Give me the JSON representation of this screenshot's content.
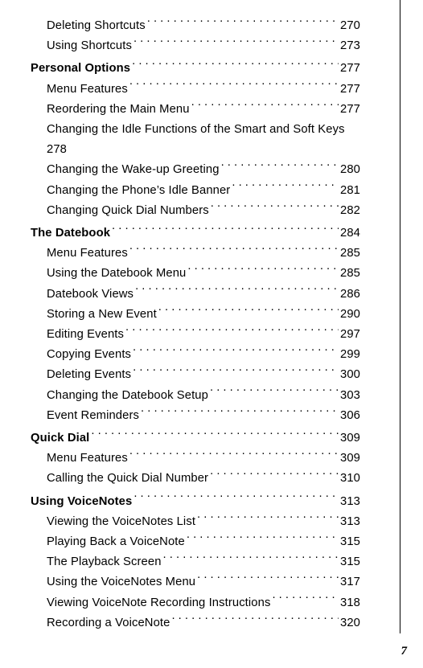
{
  "page_number": "7",
  "entries": [
    {
      "label": "Deleting Shortcuts",
      "page": "270",
      "bold": false,
      "indent": true,
      "breakBefore": false
    },
    {
      "label": "Using Shortcuts",
      "page": "273",
      "bold": false,
      "indent": true,
      "breakBefore": false
    },
    {
      "label": "Personal Options",
      "page": "277",
      "bold": true,
      "indent": false,
      "breakBefore": true
    },
    {
      "label": "Menu Features",
      "page": "277",
      "bold": false,
      "indent": true,
      "breakBefore": false
    },
    {
      "label": "Reordering the Main Menu",
      "page": "277",
      "bold": false,
      "indent": true,
      "breakBefore": false
    },
    {
      "label": "Changing the Idle Functions of the Smart and Soft Keys",
      "page": "278",
      "bold": false,
      "indent": true,
      "breakBefore": false,
      "wrap": true
    },
    {
      "label": "Changing the Wake-up Greeting",
      "page": "280",
      "bold": false,
      "indent": true,
      "breakBefore": false
    },
    {
      "label": "Changing the Phone’s Idle Banner",
      "page": "281",
      "bold": false,
      "indent": true,
      "breakBefore": false
    },
    {
      "label": "Changing Quick Dial Numbers",
      "page": "282",
      "bold": false,
      "indent": true,
      "breakBefore": false
    },
    {
      "label": "The Datebook",
      "page": "284",
      "bold": true,
      "indent": false,
      "breakBefore": true
    },
    {
      "label": "Menu Features",
      "page": "285",
      "bold": false,
      "indent": true,
      "breakBefore": false
    },
    {
      "label": "Using the Datebook Menu",
      "page": "285",
      "bold": false,
      "indent": true,
      "breakBefore": false
    },
    {
      "label": "Datebook Views",
      "page": "286",
      "bold": false,
      "indent": true,
      "breakBefore": false
    },
    {
      "label": "Storing a New Event",
      "page": "290",
      "bold": false,
      "indent": true,
      "breakBefore": false
    },
    {
      "label": "Editing Events",
      "page": "297",
      "bold": false,
      "indent": true,
      "breakBefore": false
    },
    {
      "label": "Copying Events",
      "page": "299",
      "bold": false,
      "indent": true,
      "breakBefore": false
    },
    {
      "label": "Deleting Events",
      "page": "300",
      "bold": false,
      "indent": true,
      "breakBefore": false
    },
    {
      "label": "Changing the Datebook Setup",
      "page": "303",
      "bold": false,
      "indent": true,
      "breakBefore": false
    },
    {
      "label": "Event Reminders",
      "page": "306",
      "bold": false,
      "indent": true,
      "breakBefore": false
    },
    {
      "label": "Quick Dial",
      "page": "309",
      "bold": true,
      "indent": false,
      "breakBefore": true
    },
    {
      "label": "Menu Features",
      "page": "309",
      "bold": false,
      "indent": true,
      "breakBefore": false
    },
    {
      "label": "Calling the Quick Dial Number",
      "page": "310",
      "bold": false,
      "indent": true,
      "breakBefore": false
    },
    {
      "label": "Using VoiceNotes",
      "page": "313",
      "bold": true,
      "indent": false,
      "breakBefore": true
    },
    {
      "label": "Viewing the VoiceNotes List",
      "page": "313",
      "bold": false,
      "indent": true,
      "breakBefore": false
    },
    {
      "label": "Playing Back a VoiceNote",
      "page": "315",
      "bold": false,
      "indent": true,
      "breakBefore": false
    },
    {
      "label": "The Playback Screen",
      "page": "315",
      "bold": false,
      "indent": true,
      "breakBefore": false
    },
    {
      "label": "Using the VoiceNotes Menu",
      "page": "317",
      "bold": false,
      "indent": true,
      "breakBefore": false
    },
    {
      "label": "Viewing VoiceNote Recording Instructions",
      "page": "318",
      "bold": false,
      "indent": true,
      "breakBefore": false
    },
    {
      "label": "Recording a VoiceNote",
      "page": "320",
      "bold": false,
      "indent": true,
      "breakBefore": false
    }
  ]
}
